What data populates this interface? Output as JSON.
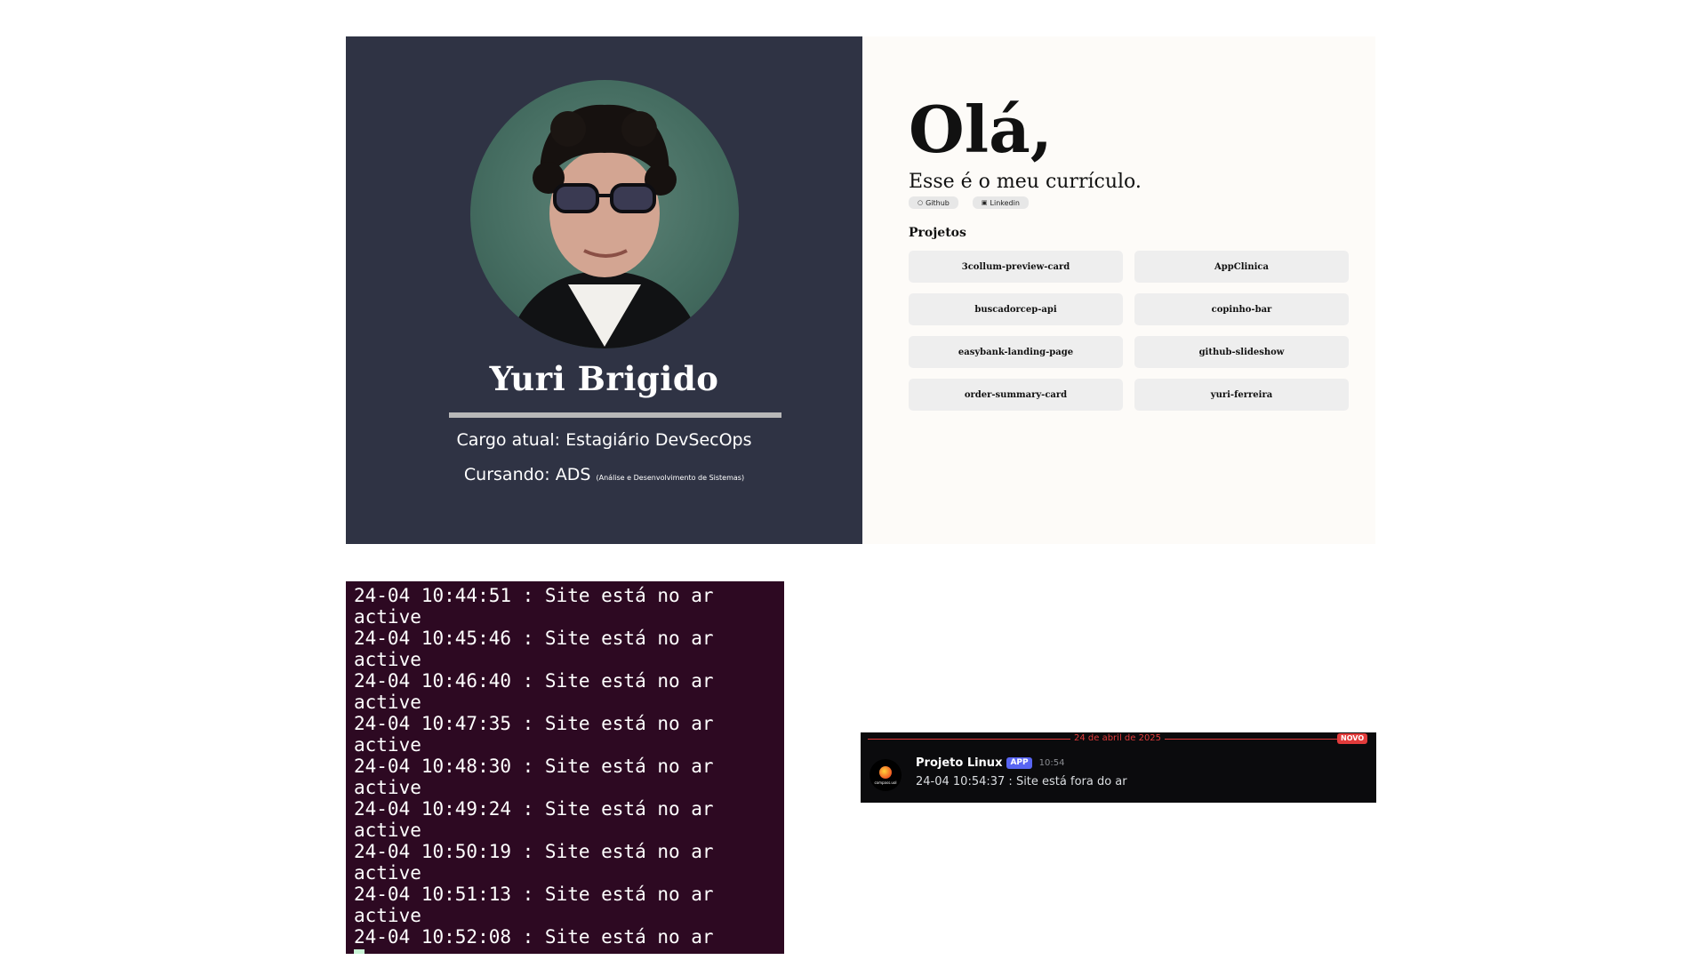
{
  "resume": {
    "name": "Yuri Brigido",
    "role": "Cargo atual: Estagiário DevSecOps",
    "course_prefix": "Cursando: ",
    "course": "ADS",
    "course_detail": "(Análise e Desenvolvimento de Sistemas)",
    "greeting": "Olá,",
    "subtitle": "Esse é o meu currículo.",
    "social": [
      {
        "icon": "github-icon",
        "glyph": "○",
        "label": "Github"
      },
      {
        "icon": "linkedin-icon",
        "glyph": "▣",
        "label": "Linkedin"
      }
    ],
    "projects_title": "Projetos",
    "projects": [
      "3collum-preview-card",
      "AppClinica",
      "buscadorcep-api",
      "copinho-bar",
      "easybank-landing-page",
      "github-slideshow",
      "order-summary-card",
      "yuri-ferreira"
    ]
  },
  "terminal": {
    "lines": [
      "24-04 10:44:51 : Site está no ar",
      "active",
      "24-04 10:45:46 : Site está no ar",
      "active",
      "24-04 10:46:40 : Site está no ar",
      "active",
      "24-04 10:47:35 : Site está no ar",
      "active",
      "24-04 10:48:30 : Site está no ar",
      "active",
      "24-04 10:49:24 : Site está no ar",
      "active",
      "24-04 10:50:19 : Site está no ar",
      "active",
      "24-04 10:51:13 : Site está no ar",
      "active",
      "24-04 10:52:08 : Site está no ar"
    ]
  },
  "notification": {
    "date": "24 de abril de 2025",
    "new_badge": "NOVO",
    "avatar_brand": "compass.uol",
    "author": "Projeto Linux",
    "app_badge": "APP",
    "time": "10:54",
    "message": "24-04 10:54:37 : Site está fora do ar"
  },
  "colors": {
    "profile_bg": "#2f3344",
    "intro_bg": "#fdfbf8",
    "terminal_bg": "#2d0922",
    "notif_bg": "#0b0b0d",
    "notif_accent": "#e23b3b",
    "app_badge": "#5865f2"
  }
}
